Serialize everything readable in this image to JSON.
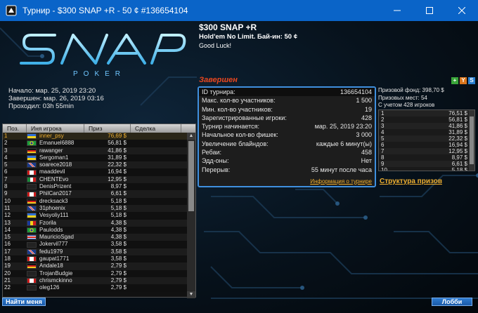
{
  "window": {
    "title": "Турнир - $300 SNAP +R - 50 ¢ #136654104"
  },
  "left_info": {
    "start": "Начало: мар. 25, 2019 23:20",
    "end": "Завершен: мар. 26, 2019 03:16",
    "duration": "Проходил: 03h 55min"
  },
  "players": {
    "headers": [
      "Поз.",
      "Иня игрока",
      "Приз",
      "Сделка"
    ],
    "rows": [
      {
        "pos": "1",
        "name": "inner_psy",
        "prize": "76,69 $",
        "flag": "ukraine"
      },
      {
        "pos": "2",
        "name": "Emanuel6888",
        "prize": "56,81 $",
        "flag": "brazil"
      },
      {
        "pos": "3",
        "name": "rawanger",
        "prize": "41,86 $",
        "flag": "germany"
      },
      {
        "pos": "4",
        "name": "Sergoman1",
        "prize": "31,89 $",
        "flag": "ukraine"
      },
      {
        "pos": "5",
        "name": "soarece2018",
        "prize": "22,32 $",
        "flag": "uk"
      },
      {
        "pos": "6",
        "name": "maaddevil",
        "prize": "16,94 $",
        "flag": "canada"
      },
      {
        "pos": "7",
        "name": "CHENTEvo",
        "prize": "12,95 $",
        "flag": "mexico"
      },
      {
        "pos": "8",
        "name": "DenisPrizent",
        "prize": "8,97 $",
        "flag": "none"
      },
      {
        "pos": "9",
        "name": "PhilCan2017",
        "prize": "6,61 $",
        "flag": "canada"
      },
      {
        "pos": "10",
        "name": "drecksack3",
        "prize": "5,18 $",
        "flag": "germany"
      },
      {
        "pos": "11",
        "name": "31phoenix",
        "prize": "5,18 $",
        "flag": "uk"
      },
      {
        "pos": "12",
        "name": "Vesyoliy111",
        "prize": "5,18 $",
        "flag": "ukraine"
      },
      {
        "pos": "13",
        "name": "Fzorila",
        "prize": "4,38 $",
        "flag": "romania"
      },
      {
        "pos": "14",
        "name": "Paulodds",
        "prize": "4,38 $",
        "flag": "brazil"
      },
      {
        "pos": "15",
        "name": "MauricioSgad",
        "prize": "4,38 $",
        "flag": "costarica"
      },
      {
        "pos": "16",
        "name": "Jokervil777",
        "prize": "3,58 $",
        "flag": "none"
      },
      {
        "pos": "17",
        "name": "fedu1979",
        "prize": "3,58 $",
        "flag": "uk"
      },
      {
        "pos": "18",
        "name": "gaupat1771",
        "prize": "3,58 $",
        "flag": "canada"
      },
      {
        "pos": "19",
        "name": "Andale18",
        "prize": "2,79 $",
        "flag": "germany"
      },
      {
        "pos": "20",
        "name": "TrojanBudgie",
        "prize": "2,79 $",
        "flag": "none"
      },
      {
        "pos": "21",
        "name": "chrismckinno",
        "prize": "2,79 $",
        "flag": "canada"
      },
      {
        "pos": "22",
        "name": "oleg126",
        "prize": "2,79 $",
        "flag": "none"
      }
    ]
  },
  "find_me": "Найти меня",
  "tournament": {
    "name": "$300 SNAP +R",
    "subtitle": "Hold'em No Limit. Бай-ин: 50 ¢",
    "message": "Good Luck!",
    "status": "Завершен"
  },
  "details": [
    {
      "label": "ID турнира:",
      "value": "136654104"
    },
    {
      "label": "Макс. кол-во участников:",
      "value": "1 500"
    },
    {
      "label": "Мин. кол-во участников:",
      "value": "19"
    },
    {
      "label": "Зарегистрированные игроки:",
      "value": "428"
    },
    {
      "label": "Турнир начинается:",
      "value": "мар. 25, 2019 23:20"
    },
    {
      "label": "Начальное кол-во фишек:",
      "value": "3 000"
    },
    {
      "label": "Увеличение блайндов:",
      "value": "каждые 6 минут(ы)"
    },
    {
      "label": "Ребаи:",
      "value": "458"
    },
    {
      "label": "Эдд-оны:",
      "value": "Нет"
    },
    {
      "label": "Перерыв:",
      "value": "55 минут после часа"
    }
  ],
  "info_link": "Информация о турнире",
  "prize_info": {
    "pool": "Призовой фонд: 398,70 $",
    "places": "Призовых мест: 54",
    "accounting": "С учетом 428 игроков",
    "rows": [
      {
        "place": "1",
        "amount": "76,51 $"
      },
      {
        "place": "2",
        "amount": "56,81 $"
      },
      {
        "place": "3",
        "amount": "41,86 $"
      },
      {
        "place": "4",
        "amount": "31,89 $"
      },
      {
        "place": "5",
        "amount": "22,32 $"
      },
      {
        "place": "6",
        "amount": "16,94 $"
      },
      {
        "place": "7",
        "amount": "12,95 $"
      },
      {
        "place": "8",
        "amount": "8,97 $"
      },
      {
        "place": "9",
        "amount": "6,61 $"
      },
      {
        "place": "10",
        "amount": "5,18 $"
      }
    ]
  },
  "prize_link": "Структура призов",
  "lobby": "Лобби"
}
